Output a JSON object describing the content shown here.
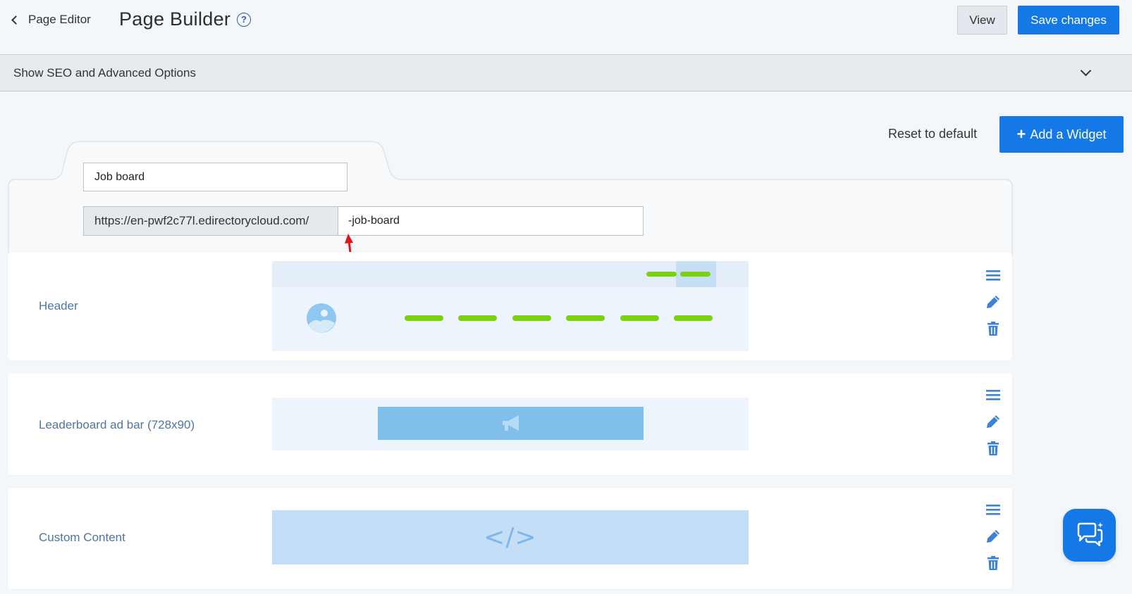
{
  "header": {
    "back_label": "Page Editor",
    "title": "Page Builder",
    "help_symbol": "?",
    "view_label": "View",
    "save_label": "Save changes"
  },
  "seo_bar": {
    "label": "Show SEO and Advanced Options"
  },
  "actions": {
    "reset_label": "Reset to default",
    "add_widget_label": "Add a Widget"
  },
  "page_form": {
    "title_value": "Job board",
    "url_prefix": "https://en-pwf2c77l.edirectorycloud.com/",
    "url_slug_value": "-job-board"
  },
  "widgets": [
    {
      "label": "Header"
    },
    {
      "label": "Leaderboard ad bar (728x90)"
    },
    {
      "label": "Custom Content",
      "preview_symbol": "</>"
    }
  ],
  "icons": {
    "drag": "hamburger-icon",
    "edit": "pencil-icon",
    "delete": "trash-icon",
    "chat": "chat-bubbles-icon",
    "ad": "megaphone-icon",
    "logo": "image-placeholder-icon"
  },
  "colors": {
    "primary": "#1479e6",
    "green_line": "#7cd10f",
    "label_blue": "#4a77a3",
    "icon_blue": "#3b82d8",
    "arrow_red": "#e3141b"
  }
}
